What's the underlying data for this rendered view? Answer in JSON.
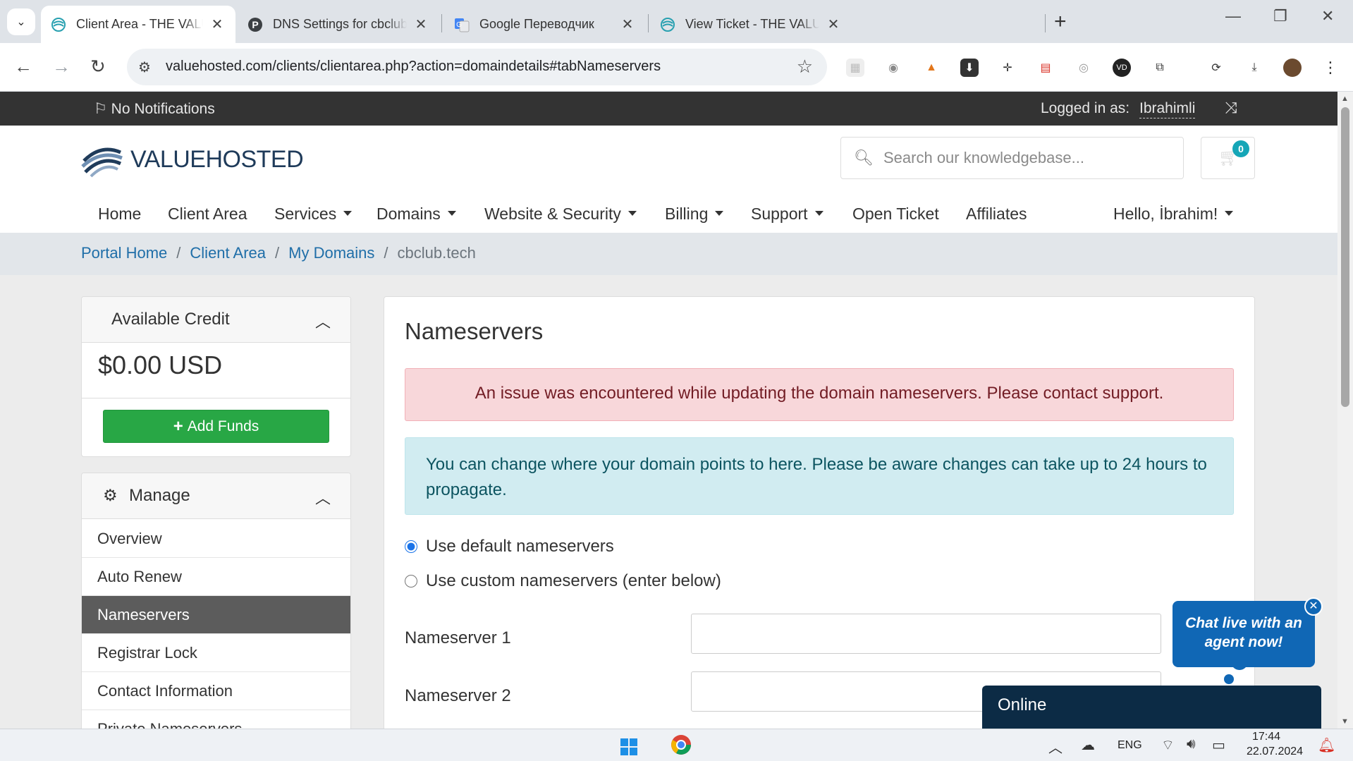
{
  "browser": {
    "tabs": [
      {
        "title": "Client Area - THE VALUE HOSTED",
        "active": true,
        "favicon": "valuehosted-swirl-icon"
      },
      {
        "title": "DNS Settings for cbclub.tech - Value Hosted",
        "active": false,
        "favicon": "p-circle-icon"
      },
      {
        "title": "Google Переводчик",
        "active": false,
        "favicon": "google-translate-icon"
      },
      {
        "title": "View Ticket - THE VALUE HOSTED",
        "active": false,
        "favicon": "valuehosted-swirl-icon"
      }
    ],
    "url": "valuehosted.com/clients/clientarea.php?action=domaindetails#tabNameservers"
  },
  "topbar": {
    "notifications": "No Notifications",
    "logged_in_label": "Logged in as:",
    "username": "Ibrahimli"
  },
  "header": {
    "logo_text": "VALUEHOSTED",
    "search_placeholder": "Search our knowledgebase...",
    "cart_count": "0"
  },
  "nav": {
    "items": [
      {
        "label": "Home",
        "dropdown": false
      },
      {
        "label": "Client Area",
        "dropdown": false
      },
      {
        "label": "Services",
        "dropdown": true
      },
      {
        "label": "Domains",
        "dropdown": true
      },
      {
        "label": "Website & Security",
        "dropdown": true
      },
      {
        "label": "Billing",
        "dropdown": true
      },
      {
        "label": "Support",
        "dropdown": true
      },
      {
        "label": "Open Ticket",
        "dropdown": false
      },
      {
        "label": "Affiliates",
        "dropdown": false
      }
    ],
    "greeting": "Hello, İbrahim!"
  },
  "breadcrumb": {
    "items": [
      "Portal Home",
      "Client Area",
      "My Domains"
    ],
    "current": "cbclub.tech"
  },
  "sidebar": {
    "credit": {
      "title": "Available Credit",
      "amount": "$0.00 USD",
      "add_funds_label": "Add Funds"
    },
    "manage": {
      "title": "Manage",
      "items": [
        "Overview",
        "Auto Renew",
        "Nameservers",
        "Registrar Lock",
        "Contact Information",
        "Private Nameservers"
      ],
      "active_index": 2
    }
  },
  "main": {
    "title": "Nameservers",
    "error_message": "An issue was encountered while updating the domain nameservers. Please contact support.",
    "info_message": "You can change where your domain points to here. Please be aware changes can take up to 24 hours to propagate.",
    "radio_default": "Use default nameservers",
    "radio_custom": "Use custom nameservers (enter below)",
    "selected_option": "default",
    "nameserver_1_label": "Nameserver 1",
    "nameserver_2_label": "Nameserver 2"
  },
  "chat": {
    "bubble_text": "Chat live with an agent now!",
    "status": "Online"
  },
  "taskbar": {
    "language": "ENG",
    "time": "17:44",
    "date": "22.07.2024"
  },
  "colors": {
    "topbar_bg": "#333333",
    "accent_link": "#1f6ea8",
    "success": "#28a745",
    "danger_bg": "#f8d7da",
    "info_bg": "#d1ecf1",
    "chat_blue": "#1067b5",
    "chat_dark": "#0c2b45"
  }
}
